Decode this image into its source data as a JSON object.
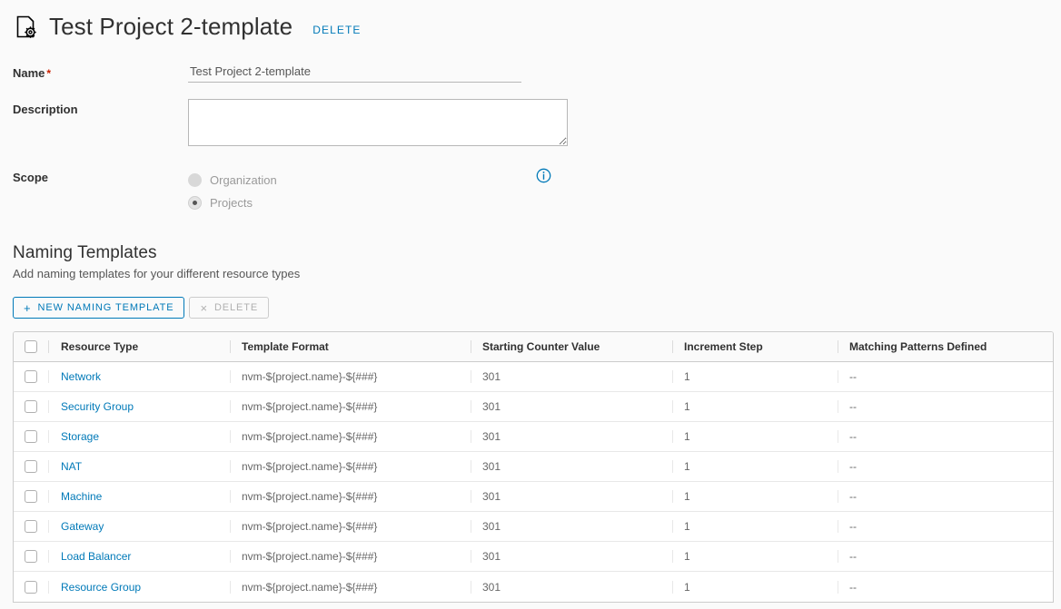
{
  "header": {
    "icon": "document-gear-icon",
    "title": "Test Project 2-template",
    "delete_label": "DELETE"
  },
  "form": {
    "name": {
      "label": "Name",
      "required_marker": "*",
      "value": "Test Project 2-template",
      "placeholder": ""
    },
    "description": {
      "label": "Description",
      "value": "",
      "placeholder": ""
    },
    "scope": {
      "label": "Scope",
      "info_icon": "info-circle-icon",
      "options": [
        {
          "label": "Organization",
          "selected": false
        },
        {
          "label": "Projects",
          "selected": true
        }
      ]
    }
  },
  "naming_templates": {
    "section_title": "Naming Templates",
    "section_subtitle": "Add naming templates for your different resource types",
    "new_button": {
      "label": "NEW NAMING TEMPLATE",
      "glyph": "+",
      "icon": "plus-icon"
    },
    "delete_button": {
      "label": "DELETE",
      "glyph": "×",
      "icon": "close-x-icon",
      "disabled": true
    },
    "columns": [
      "Resource Type",
      "Template Format",
      "Starting Counter Value",
      "Increment Step",
      "Matching Patterns Defined"
    ],
    "rows": [
      {
        "resource_type": "Network",
        "template_format": "nvm-${project.name}-${###}",
        "starting_counter_value": "301",
        "increment_step": "1",
        "matching_patterns_defined": "--"
      },
      {
        "resource_type": "Security Group",
        "template_format": "nvm-${project.name}-${###}",
        "starting_counter_value": "301",
        "increment_step": "1",
        "matching_patterns_defined": "--"
      },
      {
        "resource_type": "Storage",
        "template_format": "nvm-${project.name}-${###}",
        "starting_counter_value": "301",
        "increment_step": "1",
        "matching_patterns_defined": "--"
      },
      {
        "resource_type": "NAT",
        "template_format": "nvm-${project.name}-${###}",
        "starting_counter_value": "301",
        "increment_step": "1",
        "matching_patterns_defined": "--"
      },
      {
        "resource_type": "Machine",
        "template_format": "nvm-${project.name}-${###}",
        "starting_counter_value": "301",
        "increment_step": "1",
        "matching_patterns_defined": "--"
      },
      {
        "resource_type": "Gateway",
        "template_format": "nvm-${project.name}-${###}",
        "starting_counter_value": "301",
        "increment_step": "1",
        "matching_patterns_defined": "--"
      },
      {
        "resource_type": "Load Balancer",
        "template_format": "nvm-${project.name}-${###}",
        "starting_counter_value": "301",
        "increment_step": "1",
        "matching_patterns_defined": "--"
      },
      {
        "resource_type": "Resource Group",
        "template_format": "nvm-${project.name}-${###}",
        "starting_counter_value": "301",
        "increment_step": "1",
        "matching_patterns_defined": "--"
      }
    ]
  },
  "colors": {
    "accent": "#0079b8",
    "required": "#c92100",
    "text": "#565656",
    "heading": "#313131",
    "page_background": "#fafafa"
  }
}
